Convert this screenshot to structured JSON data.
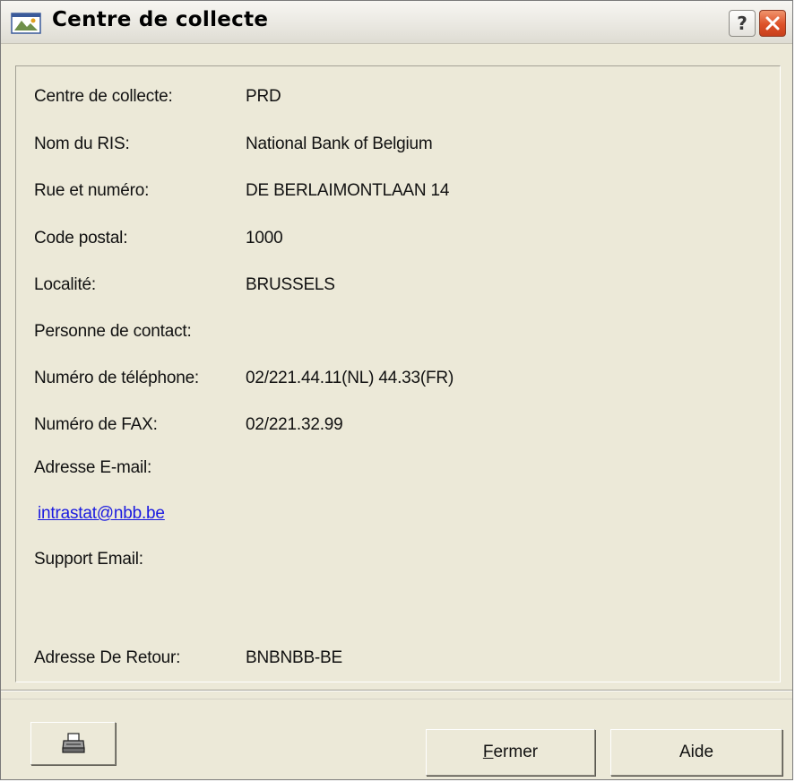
{
  "window": {
    "title": "Centre de collecte",
    "help_label": "?"
  },
  "fields": [
    {
      "label": "Centre de collecte:",
      "value": "PRD"
    },
    {
      "label": "Nom du RIS:",
      "value": "National Bank of Belgium"
    },
    {
      "label": "Rue et numéro:",
      "value": "DE BERLAIMONTLAAN 14"
    },
    {
      "label": "Code postal:",
      "value": "1000"
    },
    {
      "label": "Localité:",
      "value": "BRUSSELS"
    },
    {
      "label": "Personne de contact:",
      "value": ""
    },
    {
      "label": "Numéro de téléphone:",
      "value": "02/221.44.11(NL) 44.33(FR)"
    },
    {
      "label": "Numéro de FAX:",
      "value": "02/221.32.99"
    },
    {
      "label": "Adresse E-mail:",
      "value": ""
    },
    {
      "label": "Support Email:",
      "value": ""
    },
    {
      "label": "Adresse De Retour:",
      "value": "BNBNBB-BE"
    }
  ],
  "email_link": "intrastat@nbb.be",
  "buttons": {
    "print_icon": "printer-icon",
    "fermer_accel": "F",
    "fermer_rest": "ermer",
    "aide": "Aide"
  },
  "colors": {
    "window_bg": "#ece9d8",
    "link": "#1a1ae0",
    "close_button": "#dd5128"
  }
}
